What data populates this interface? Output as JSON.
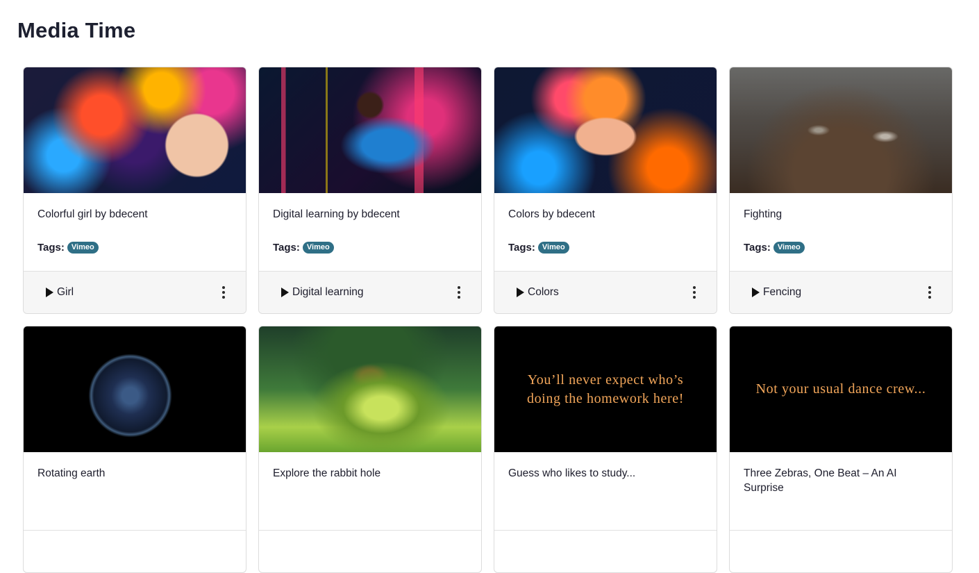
{
  "page": {
    "title": "Media Time"
  },
  "labels": {
    "tags": "Tags:"
  },
  "colors": {
    "tag_badge": "#2f6f86",
    "footer_bg": "#f6f6f6",
    "thumb_caption": "#f2a65a"
  },
  "cards": [
    {
      "title": "Colorful girl by bdecent",
      "tag": "Vimeo",
      "play_label": "Girl",
      "thumb_caption": ""
    },
    {
      "title": "Digital learning by bdecent",
      "tag": "Vimeo",
      "play_label": "Digital learning",
      "thumb_caption": ""
    },
    {
      "title": "Colors by bdecent",
      "tag": "Vimeo",
      "play_label": "Colors",
      "thumb_caption": ""
    },
    {
      "title": "Fighting",
      "tag": "Vimeo",
      "play_label": "Fencing",
      "thumb_caption": ""
    },
    {
      "title": "Rotating earth",
      "tag": "",
      "play_label": "",
      "thumb_caption": ""
    },
    {
      "title": "Explore the rabbit hole",
      "tag": "",
      "play_label": "",
      "thumb_caption": ""
    },
    {
      "title": "Guess who likes to study...",
      "tag": "",
      "play_label": "",
      "thumb_caption": "You’ll never expect who’s doing the homework here!"
    },
    {
      "title": "Three Zebras, One Beat – An AI Surprise",
      "tag": "",
      "play_label": "",
      "thumb_caption": "Not your usual dance crew..."
    }
  ],
  "icons": {
    "play": "play-icon",
    "more": "more-vertical-icon"
  }
}
